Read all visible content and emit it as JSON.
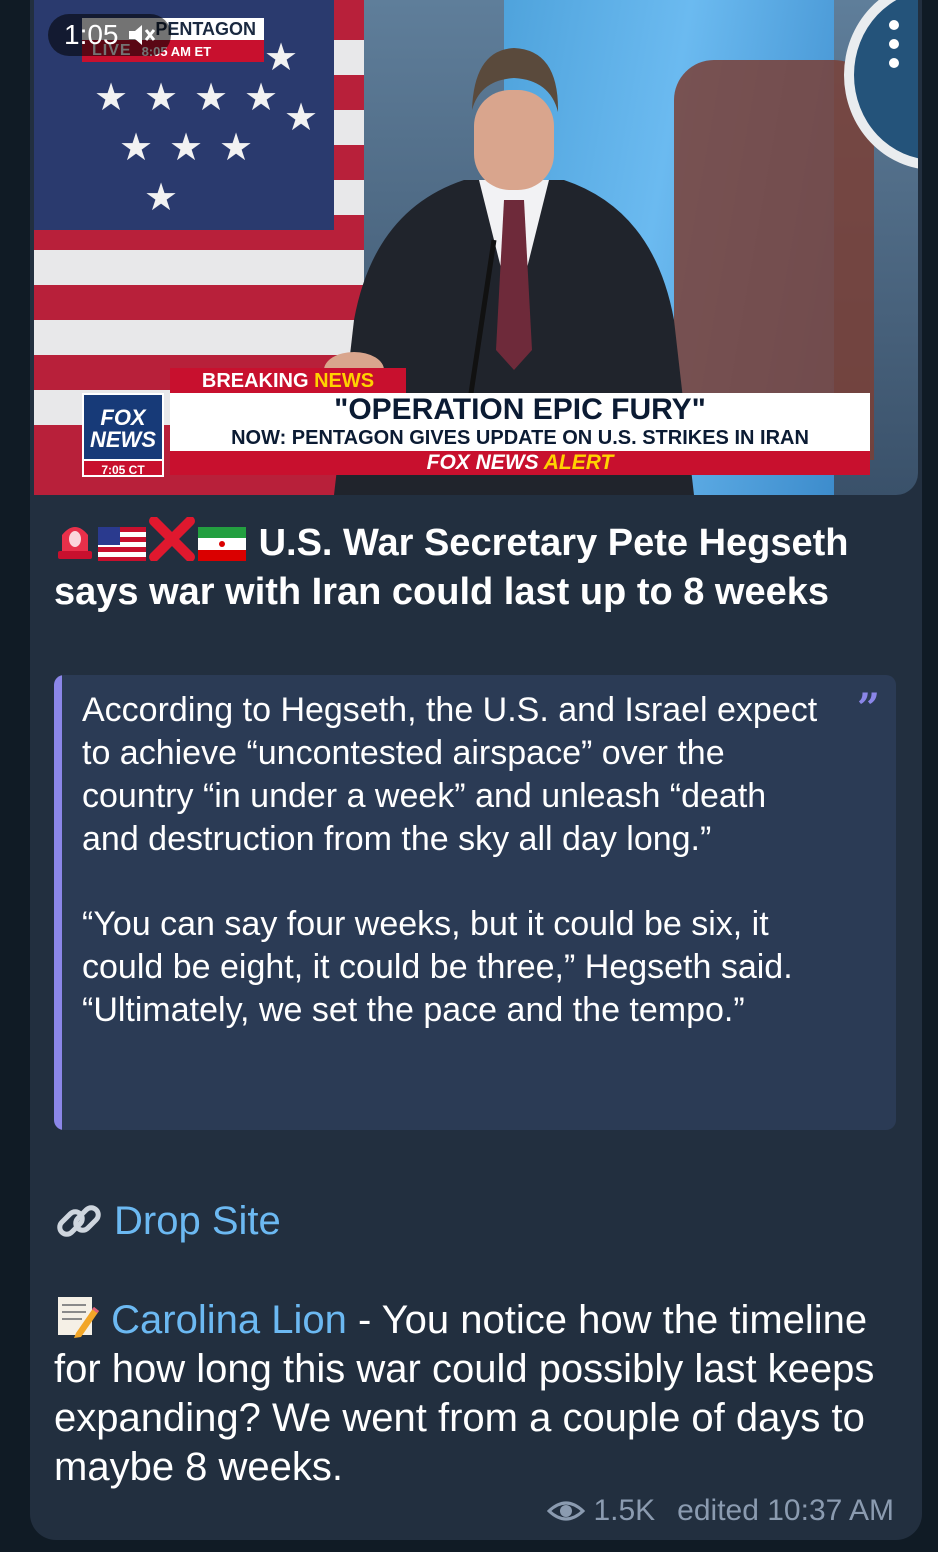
{
  "video": {
    "time": "1:05",
    "muted_icon": "speaker-muted-icon",
    "overlay_pentagon": "PENTAGON",
    "overlay_live": "LIVE",
    "overlay_live_time": "8:05 AM ET",
    "fox_logo_line1": "FOX",
    "fox_logo_line2": "NEWS",
    "fox_time": "7:05 CT",
    "breaking_word1": "BREAKING",
    "breaking_word2": "NEWS",
    "headline": "\"OPERATION EPIC FURY\"",
    "subheadline": "NOW: PENTAGON GIVES UPDATE ON U.S. STRIKES IN IRAN",
    "alert_word1": "FOX NEWS",
    "alert_word2": "ALERT",
    "menu_icon": "more-vertical-icon"
  },
  "post": {
    "title": "U.S. War Secretary Pete Hegseth says war with Iran could last up to 8 weeks",
    "title_emojis": [
      "siren-icon",
      "us-flag-icon",
      "cross-mark-icon",
      "iran-flag-icon"
    ],
    "quote_p1": "According to Hegseth, the U.S. and Israel expect to achieve “uncontested airspace” over the country “in under a week” and unleash “death and destruction from the sky all day long.”",
    "quote_p2": "“You can say four weeks, but it could be six, it could be eight, it could be three,” Hegseth said. “Ultimately, we set the pace and the tempo.”",
    "link_label": "Drop Site",
    "author": "Carolina Lion",
    "comment": " - You notice how the timeline for how long this war could possibly last keeps expanding? We went from a couple of days to maybe 8 weeks.",
    "views": "1.5K",
    "edited": "edited 10:37 AM"
  },
  "colors": {
    "bubble": "#222f3f",
    "quote_bg": "#2b3b55",
    "quote_accent": "#8b86e8",
    "link": "#6cb9f2",
    "meta": "#8b9bb0"
  }
}
